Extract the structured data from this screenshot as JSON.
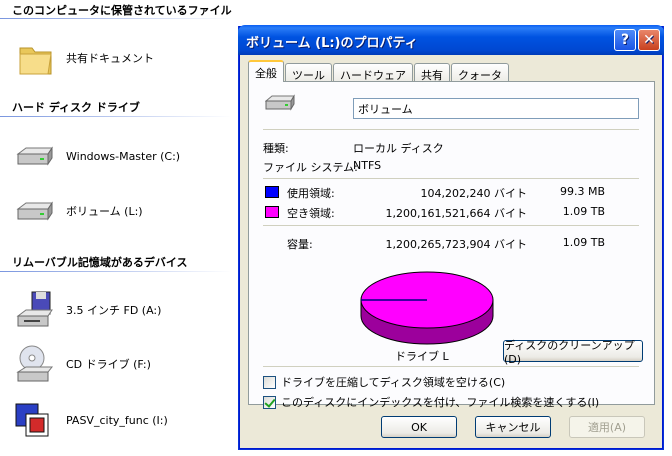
{
  "explorer": {
    "groups": [
      {
        "title": "このコンピュータに保管されているファイル"
      },
      {
        "title": "ハード ディスク ドライブ"
      },
      {
        "title": "リムーバブル記憶域があるデバイス"
      }
    ],
    "items": [
      {
        "label": "共有ドキュメント",
        "icon": "folder-icon"
      },
      {
        "label": "Windows-Master (C:)",
        "icon": "hard-drive-icon"
      },
      {
        "label": "ボリューム (L:)",
        "icon": "hard-drive-icon"
      },
      {
        "label": "3.5 インチ FD (A:)",
        "icon": "floppy-drive-icon"
      },
      {
        "label": "CD ドライブ (F:)",
        "icon": "cd-drive-icon"
      },
      {
        "label": "PASV_city_func (I:)",
        "icon": "removable-drive-icon"
      }
    ]
  },
  "dialog": {
    "title": "ボリューム (L:)のプロパティ",
    "help_label": "?",
    "close_label": "✕",
    "tabs": [
      "全般",
      "ツール",
      "ハードウェア",
      "共有",
      "クォータ"
    ],
    "volume_name": "ボリューム",
    "type_label": "種類:",
    "type_value": "ローカル ディスク",
    "fs_label": "ファイル システム:",
    "fs_value": "NTFS",
    "used_label": "使用領域:",
    "used_bytes": "104,202,240 バイト",
    "used_size": "99.3 MB",
    "free_label": "空き領域:",
    "free_bytes": "1,200,161,521,664 バイト",
    "free_size": "1.09 TB",
    "capacity_label": "容量:",
    "capacity_bytes": "1,200,265,723,904 バイト",
    "capacity_size": "1.09 TB",
    "drive_caption": "ドライブ L",
    "cleanup_label": "ディスクのクリーンアップ(D)",
    "compress_label": "ドライブを圧縮してディスク領域を空ける(C)",
    "index_label": "このディスクにインデックスを付け、ファイル検索を速くする(I)",
    "compress_checked": false,
    "index_checked": true,
    "ok_label": "OK",
    "cancel_label": "キャンセル",
    "apply_label": "適用(A)",
    "used_fraction": 0.0001,
    "colors": {
      "used": "#0000ff",
      "free": "#ff00ff",
      "titlebar": "#0053e1"
    }
  }
}
